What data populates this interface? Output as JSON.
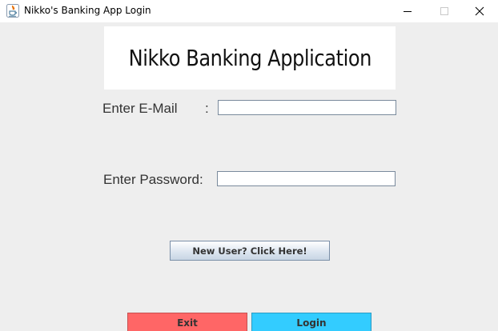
{
  "window": {
    "title": "Nikko's Banking App Login",
    "controls": {
      "minimize_icon": "minimize-icon",
      "maximize_icon": "maximize-icon",
      "close_icon": "close-icon"
    }
  },
  "banner": {
    "title": "Nikko Banking Application"
  },
  "form": {
    "email_label": "Enter E-Mail",
    "email_colon": ":",
    "email_value": "",
    "password_label": "Enter Password:",
    "password_value": ""
  },
  "buttons": {
    "new_user_label": "New User? Click Here!",
    "exit_label": "Exit",
    "login_label": "Login"
  },
  "colors": {
    "background": "#eeeeee",
    "exit_button": "#ff6666",
    "login_button": "#33ccff"
  }
}
